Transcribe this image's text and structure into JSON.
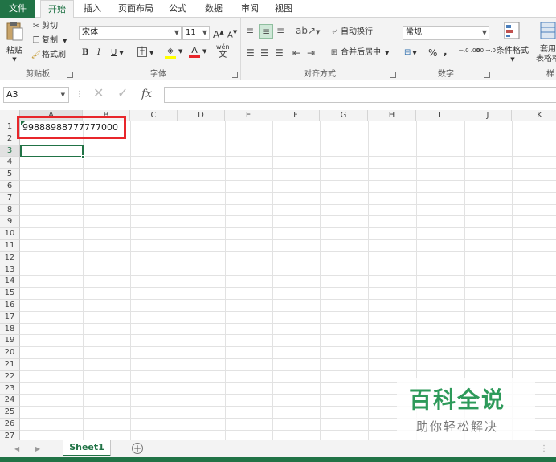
{
  "tabs": [
    "文件",
    "开始",
    "插入",
    "页面布局",
    "公式",
    "数据",
    "审阅",
    "视图"
  ],
  "clipboard": {
    "paste": "粘贴",
    "cut": "剪切",
    "copy": "复制",
    "format_painter": "格式刷",
    "label": "剪贴板"
  },
  "font": {
    "name": "宋体",
    "size": "11",
    "bold": "B",
    "italic": "I",
    "underline": "U",
    "grow": "A",
    "shrink": "A",
    "wen": "wén",
    "wen_char": "文",
    "label": "字体"
  },
  "alignment": {
    "wrap": "自动换行",
    "merge": "合并后居中",
    "label": "对齐方式"
  },
  "number": {
    "format": "常规",
    "percent": "%",
    "comma": ",",
    "inc": "←.0 .00",
    "dec": ".00 →.0",
    "label": "数字"
  },
  "styles": {
    "conditional": "条件格式",
    "table_line1": "套用",
    "table_line2": "表格格",
    "cut_label": "样"
  },
  "formula_bar": {
    "name_box": "A3",
    "fx": "fx"
  },
  "columns": [
    "A",
    "B",
    "C",
    "D",
    "E",
    "F",
    "G",
    "H",
    "I",
    "J",
    "K"
  ],
  "rows": [
    "1",
    "2",
    "3",
    "4",
    "5",
    "6",
    "7",
    "8",
    "9",
    "10",
    "11",
    "12",
    "13",
    "14",
    "15",
    "16",
    "17",
    "18",
    "19",
    "20",
    "21",
    "22",
    "23",
    "24",
    "25",
    "26",
    "27"
  ],
  "cells": {
    "A1": "99888988777777000"
  },
  "sheet": {
    "tab": "Sheet1",
    "add": "+"
  },
  "watermark": {
    "title": "百科全说",
    "subtitle": "助你轻松解决"
  },
  "colors": {
    "accent": "#217346",
    "highlight": "#e8262b"
  }
}
